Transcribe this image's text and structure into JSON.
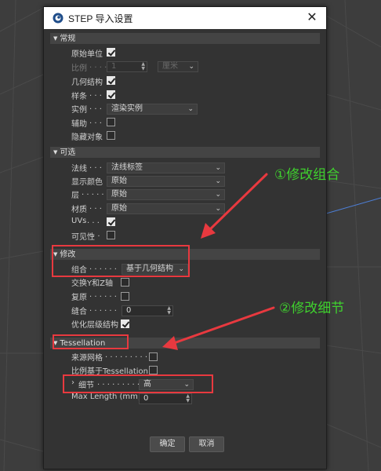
{
  "dialog": {
    "title": "STEP 导入设置",
    "close_glyph": "✕"
  },
  "sections": {
    "general": "常规",
    "optional": "可选",
    "modify": "修改",
    "tessellation": "Tessellation"
  },
  "general": {
    "original_units": {
      "label": "原始单位",
      "checked": true
    },
    "scale": {
      "label": "比例",
      "value": "1",
      "unit": "厘米"
    },
    "geometry": {
      "label": "几何结构",
      "checked": true
    },
    "splines": {
      "label": "样条",
      "checked": true
    },
    "instances": {
      "label": "实例",
      "value": "渲染实例"
    },
    "helpers": {
      "label": "辅助",
      "checked": false
    },
    "hidden_objects": {
      "label": "隐藏对象",
      "checked": false
    }
  },
  "optional": {
    "normals": {
      "label": "法线",
      "value": "法线标签"
    },
    "display_color": {
      "label": "显示颜色",
      "value": "原始"
    },
    "layers": {
      "label": "层",
      "value": "原始"
    },
    "materials": {
      "label": "材质",
      "value": "原始"
    },
    "uvs": {
      "label": "UVs",
      "checked": true
    },
    "visibility": {
      "label": "可见性",
      "checked": false
    }
  },
  "modify": {
    "combine": {
      "label": "组合",
      "value": "基于几何结构"
    },
    "swap_yz": {
      "label": "交换Y和Z轴",
      "checked": false
    },
    "restore": {
      "label": "复原",
      "checked": false
    },
    "stitch": {
      "label": "缝合",
      "value": "0"
    },
    "optimize_hierarchy": {
      "label": "优化层级结构",
      "checked": true
    }
  },
  "tessellation": {
    "source_mesh": {
      "label": "来源网格",
      "checked": false
    },
    "scale_based": {
      "label": "比例基于Tessellation",
      "checked": false
    },
    "detail": {
      "label": "细节",
      "value": "高"
    },
    "max_length": {
      "label": "Max Length (mm)",
      "value": "0"
    }
  },
  "buttons": {
    "ok": "确定",
    "cancel": "取消"
  },
  "annotations": {
    "modify_combine": "①修改组合",
    "modify_detail": "②修改细节"
  },
  "colors": {
    "annotation_green": "#3fd12e",
    "highlight_red": "#e8393f",
    "dialog_bg": "#333333"
  },
  "icons": {
    "app": "cinema4d-logo-icon",
    "close": "close-icon",
    "section_toggle": "triangle-down-icon",
    "dropdown": "chevron-down-icon"
  }
}
